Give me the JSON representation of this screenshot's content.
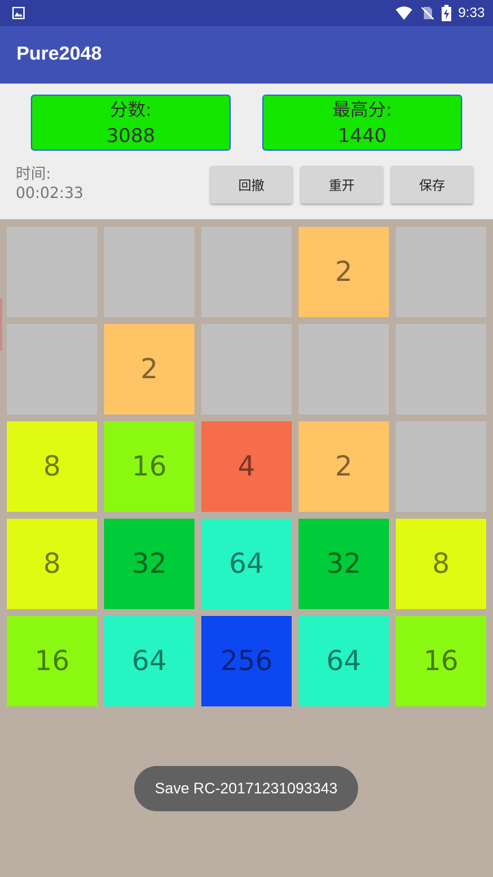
{
  "status_bar": {
    "time": "9:33",
    "icons": [
      "image-icon",
      "wifi-icon",
      "no-sim-icon",
      "battery-charging-icon"
    ]
  },
  "app": {
    "title": "Pure2048",
    "accent": "#3f51b5",
    "status_color": "#303f9f"
  },
  "score": {
    "label": "分数:",
    "value": "3088"
  },
  "best": {
    "label": "最高分:",
    "value": "1440"
  },
  "timer": {
    "label": "时间:",
    "value": "00:02:33"
  },
  "buttons": {
    "undo": "回撤",
    "restart": "重开",
    "save": "保存"
  },
  "board": {
    "size": 5,
    "rows": [
      [
        "",
        "",
        "",
        "2",
        ""
      ],
      [
        "",
        "2",
        "",
        "",
        ""
      ],
      [
        "8",
        "16",
        "4",
        "2",
        ""
      ],
      [
        "8",
        "32",
        "64",
        "32",
        "8"
      ],
      [
        "16",
        "64",
        "256",
        "64",
        "16"
      ]
    ],
    "tile_colors": {
      "empty": "#c0c0c0",
      "2": "#ffc466",
      "4": "#f56d4a",
      "8": "#e0fa12",
      "16": "#8bf812",
      "32": "#00cb38",
      "64": "#25f4c3",
      "256": "#0d47f2"
    }
  },
  "toast": {
    "text": "Save RC-20171231093343"
  }
}
